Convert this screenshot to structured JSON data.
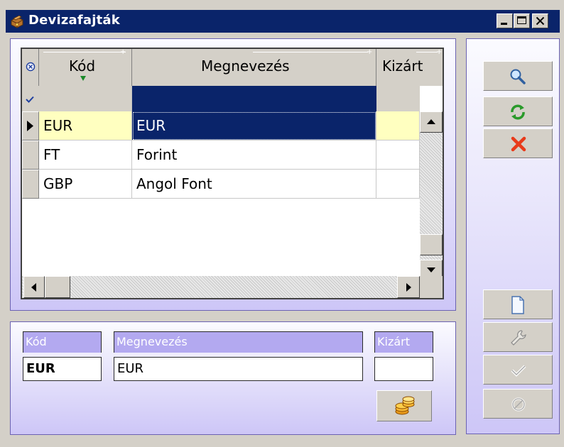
{
  "window": {
    "title": "Devizafajták",
    "icon": "treasure-chest-icon"
  },
  "grid": {
    "columns": [
      "Kód",
      "Megnevezés",
      "Kizárt"
    ],
    "rows": [
      {
        "kod": "EUR",
        "megnevezes": "EUR",
        "kizart": ""
      },
      {
        "kod": "FT",
        "megnevezes": "Forint",
        "kizart": ""
      },
      {
        "kod": "GBP",
        "megnevezes": "Angol Font",
        "kizart": ""
      }
    ],
    "selected_row": 0
  },
  "form": {
    "kod_label": "Kód",
    "megnevezes_label": "Megnevezés",
    "kizart_label": "Kizárt",
    "kod_value": "EUR",
    "megnevezes_value": "EUR",
    "kizart_value": ""
  },
  "toolbar": {
    "top": [
      "search-icon",
      "refresh-icon",
      "delete-icon"
    ],
    "bottom": [
      "new-document-icon",
      "wrench-icon",
      "checkmark-icon",
      "cancel-icon"
    ]
  },
  "colors": {
    "title_bar": "#0a246a",
    "selection": "#0a246a",
    "current_cell": "#ffffc0",
    "field_label": "#b3a9f0"
  }
}
